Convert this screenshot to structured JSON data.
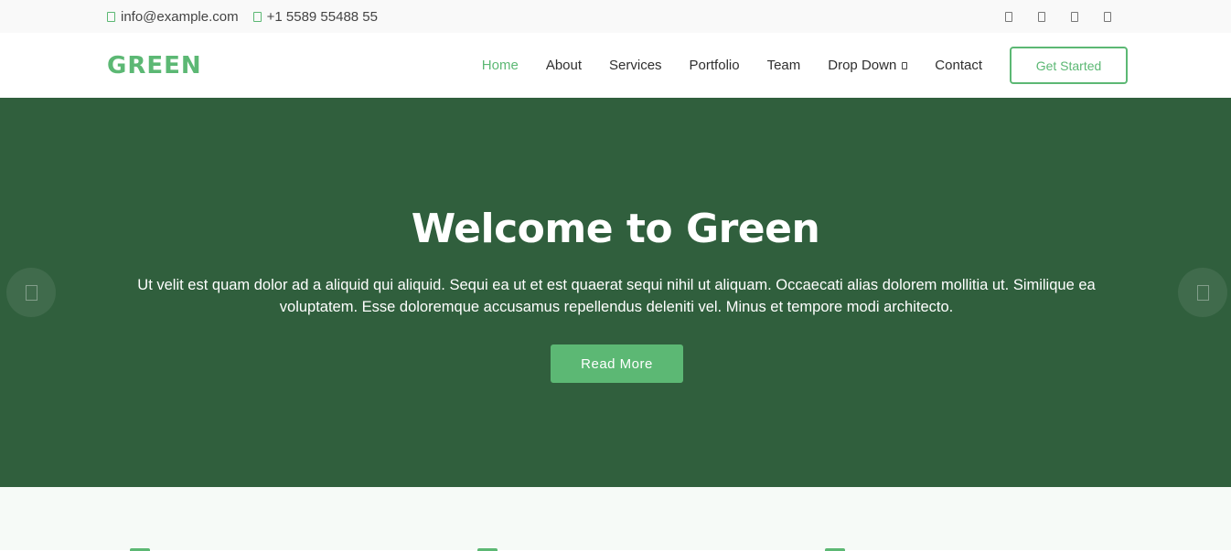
{
  "topbar": {
    "email": "info@example.com",
    "phone": "+1 5589 55488 55",
    "social_icons": [
      "twitter-icon",
      "facebook-icon",
      "instagram-icon",
      "linkedin-icon"
    ]
  },
  "navbar": {
    "logo": "GREEN",
    "menu": [
      {
        "label": "Home",
        "active": true
      },
      {
        "label": "About"
      },
      {
        "label": "Services"
      },
      {
        "label": "Portfolio"
      },
      {
        "label": "Team"
      },
      {
        "label": "Drop Down"
      },
      {
        "label": "Contact"
      }
    ],
    "cta": "Get Started"
  },
  "hero": {
    "title": "Welcome to Green",
    "text": "Ut velit est quam dolor ad a aliquid qui aliquid. Sequi ea ut et est quaerat sequi nihil ut aliquam. Occaecati alias dolorem mollitia ut. Similique ea voluptatem. Esse doloremque accusamus repellendus deleniti vel. Minus et tempore modi architecto.",
    "button": "Read More"
  },
  "colors": {
    "accent": "#5cb874",
    "hero_bg": "#305f3d"
  }
}
